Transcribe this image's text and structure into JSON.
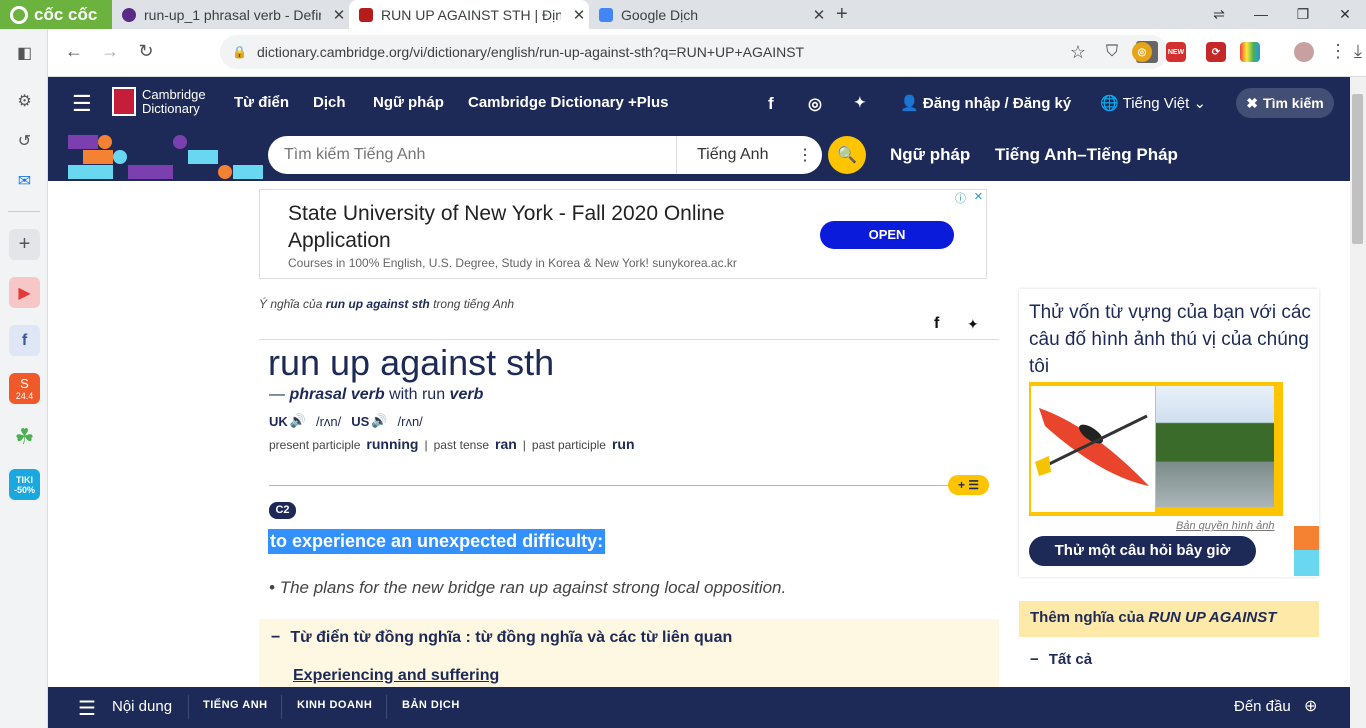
{
  "browser": {
    "brand": "cốc cốc",
    "tabs": [
      {
        "title": "run-up_1 phrasal verb - Defin",
        "favicon_color": "#5b2a86"
      },
      {
        "title": "RUN UP AGAINST STH | Định",
        "favicon_color": "#b71c1c"
      },
      {
        "title": "Google Dịch",
        "favicon_color": "#4285f4"
      }
    ],
    "url": "dictionary.cambridge.org/vi/dictionary/english/run-up-against-sth?q=RUN+UP+AGAINST",
    "extension_badge": "NEW"
  },
  "sidebar_apps": [
    "messenger-icon",
    "youtube-icon",
    "facebook-icon",
    "shopee-icon",
    "coccoc-icon",
    "tiki-icon"
  ],
  "shopee_label": "24.4",
  "tiki_label": "TIKI -50%",
  "header": {
    "logo_line1": "Cambridge",
    "logo_line2": "Dictionary",
    "nav": [
      "Từ điển",
      "Dịch",
      "Ngữ pháp",
      "Cambridge Dictionary +Plus"
    ],
    "login": "Đăng nhập / Đăng ký",
    "language": "Tiếng Việt",
    "search_toggle": "Tìm kiếm"
  },
  "search": {
    "placeholder": "Tìm kiếm Tiếng Anh",
    "dictionary": "Tiếng Anh",
    "links": [
      "Ngữ pháp",
      "Tiếng Anh–Tiếng Pháp"
    ]
  },
  "ad": {
    "title": "State University of New York - Fall 2020 Online Application",
    "subtitle": "Courses in 100% English, U.S. Degree, Study in Korea & New York! sunykorea.ac.kr",
    "button": "OPEN"
  },
  "entry": {
    "breadcrumb_prefix": "Ý nghĩa của",
    "breadcrumb_word": "run up against sth",
    "breadcrumb_suffix": "trong tiếng Anh",
    "headword": "run up against sth",
    "pos_prefix": "—",
    "pos": "phrasal verb",
    "pos_with": "with run",
    "pos_verb": "verb",
    "uk_label": "UK",
    "uk_ipa": "/rʌn/",
    "us_label": "US",
    "us_ipa": "/rʌn/",
    "forms": [
      {
        "label": "present participle",
        "value": "running"
      },
      {
        "label": "past tense",
        "value": "ran"
      },
      {
        "label": "past participle",
        "value": "run"
      }
    ],
    "level": "C2",
    "definition": "to experience an unexpected difficulty:",
    "example": "The plans for the new bridge ran up against strong local opposition.",
    "thesaurus_header": "Từ điển từ đồng nghĩa : từ đồng nghĩa và các từ liên quan",
    "thesaurus_link": "Experiencing and suffering"
  },
  "quiz": {
    "text": "Thử vốn từ vựng của bạn với các câu đố hình ảnh thú vị của chúng tôi",
    "credit": "Bản quyền hình ảnh",
    "button": "Thử một câu hỏi bây giờ"
  },
  "more": {
    "prefix": "Thêm nghĩa của",
    "term": "RUN UP AGAINST",
    "all": "Tất cả"
  },
  "bottom": {
    "contents": "Nội dung",
    "tabs": [
      "TIẾNG ANH",
      "KINH DOANH",
      "BẢN DỊCH"
    ],
    "top": "Đến đầu"
  }
}
